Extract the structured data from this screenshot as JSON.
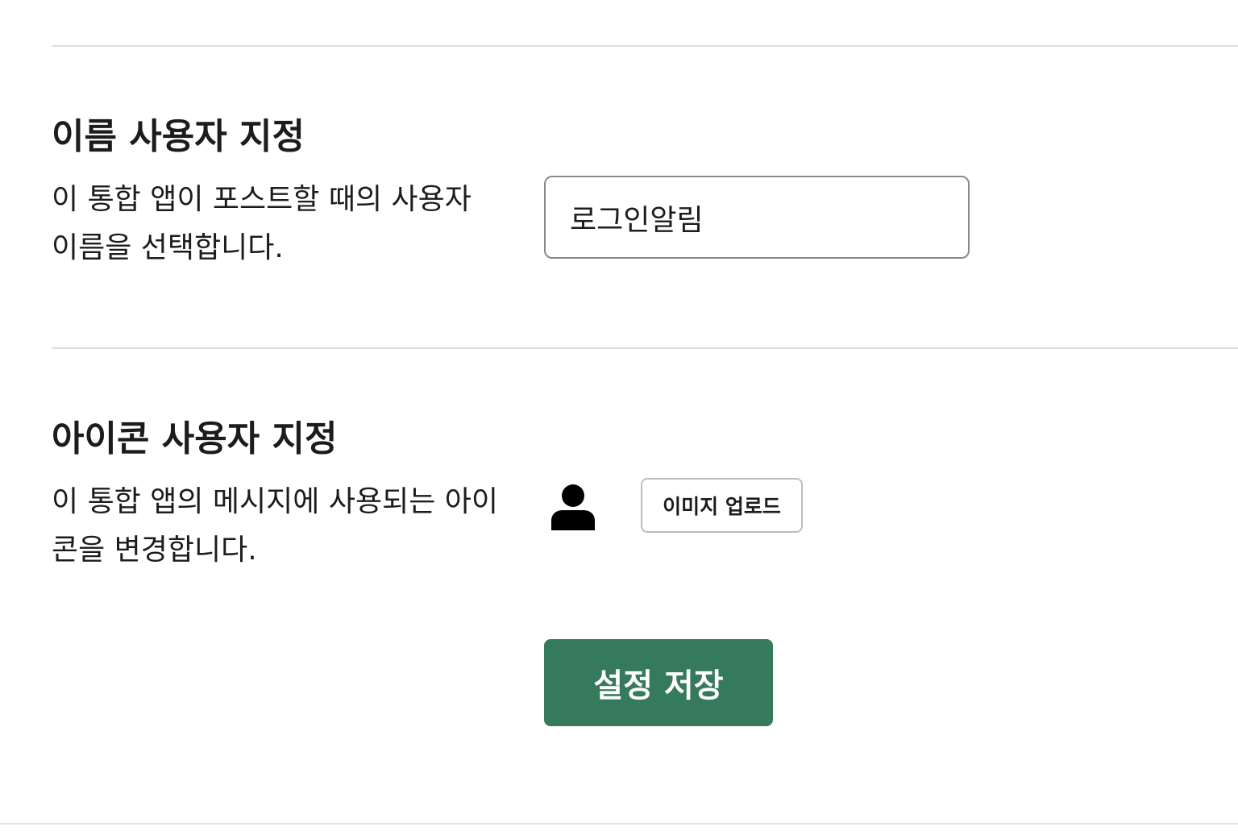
{
  "name_section": {
    "title": "이름 사용자 지정",
    "description": "이 통합 앱이 포스트할 때의 사용자 이름을 선택합니다.",
    "input_value": "로그인알림"
  },
  "icon_section": {
    "title": "아이콘 사용자 지정",
    "description": "이 통합 앱의 메시지에 사용되는 아이콘을 변경합니다.",
    "avatar_icon": "user-silhouette-icon",
    "upload_label": "이미지 업로드"
  },
  "actions": {
    "save_label": "설정 저장",
    "save_color": "#357a5b"
  }
}
